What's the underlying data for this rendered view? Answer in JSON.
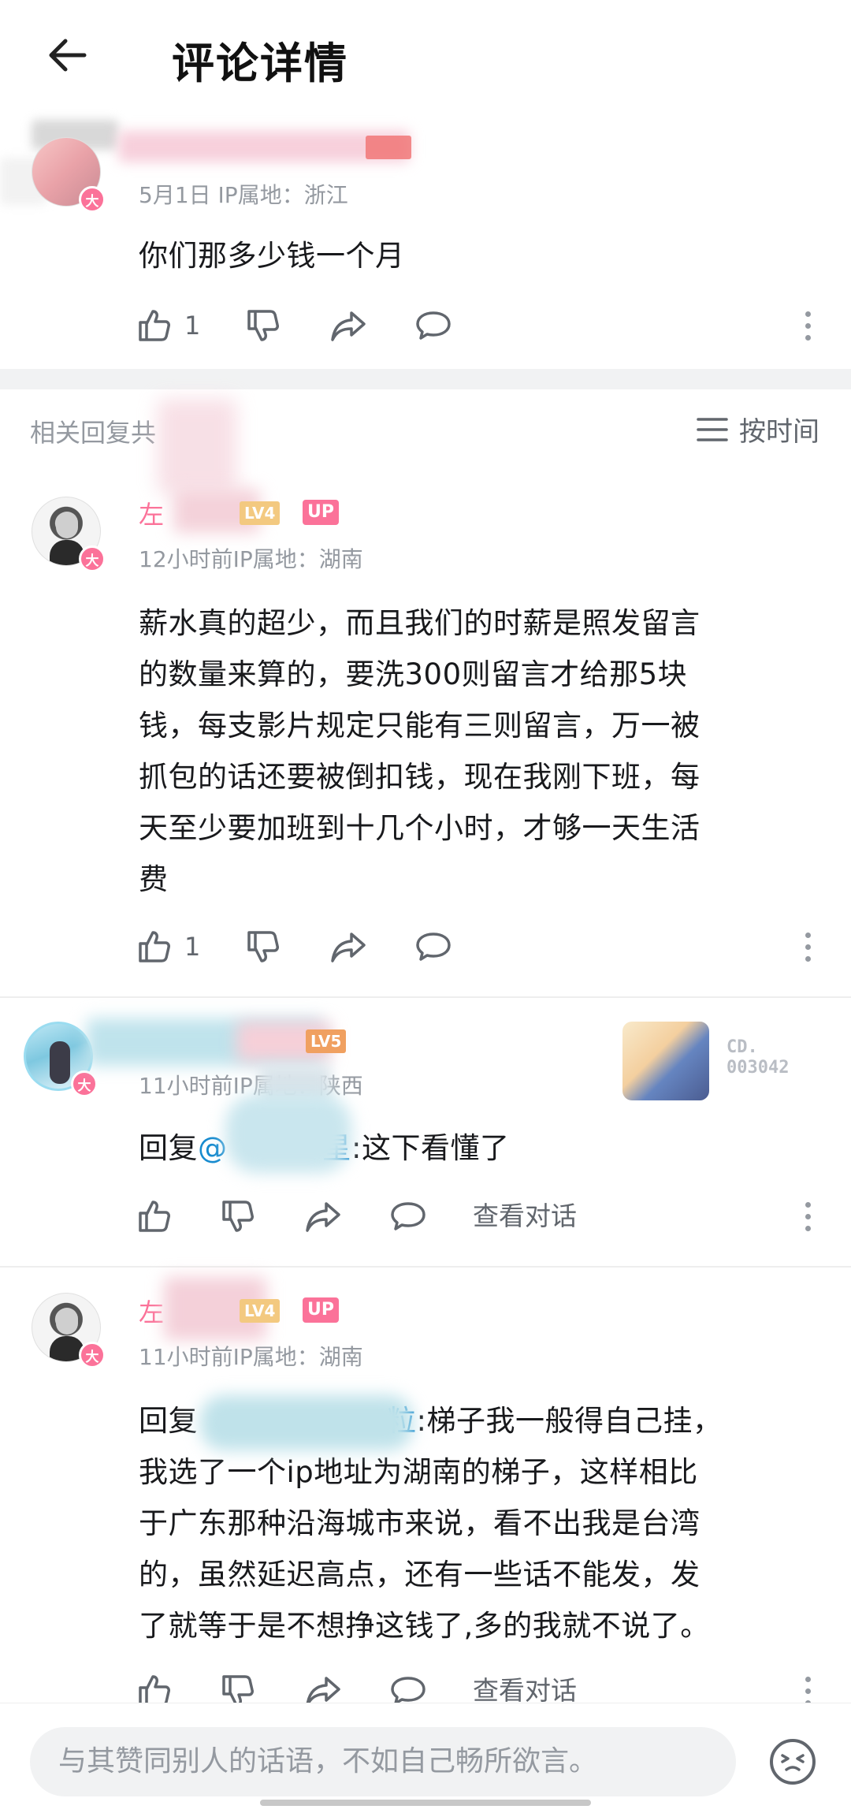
{
  "header": {
    "title": "评论详情"
  },
  "root_comment": {
    "time": "5月1日",
    "ip": "IP属地：浙江",
    "text": "你们那多少钱一个月",
    "likes": "1"
  },
  "replies_section": {
    "title": "相关回复共",
    "sort_label": "按时间"
  },
  "replies": [
    {
      "username": "左",
      "level": "LV4",
      "up_tag": "UP",
      "time": "12小时前",
      "ip": "IP属地：湖南",
      "lines": [
        "薪水真的超少，而且我们的时薪是照发留言",
        "的数量来算的，要洗300则留言才给那5块",
        "钱，每支影片规定只能有三则留言，万一被",
        "抓包的话还要被倒扣钱，现在我刚下班，每",
        "天至少要加班到十几个小时，才够一天生活",
        "费"
      ],
      "likes": "1"
    },
    {
      "level": "LV5",
      "time": "11小时前",
      "ip": "IP属地：陕西",
      "reply_prefix": "回复",
      "reply_to": "@",
      "reply_to_tail": "星",
      "text": ":这下看懂了",
      "view_conversation": "查看对话",
      "badge_number": [
        "CD.",
        "003042"
      ]
    },
    {
      "username": "左",
      "level": "LV4",
      "up_tag": "UP",
      "time": "11小时前",
      "ip": "IP属地：湖南",
      "reply_prefix": "回复",
      "reply_to_tail": "粒",
      "first_line_text": ":梯子我一般得自己挂，",
      "lines": [
        "我选了一个ip地址为湖南的梯子，这样相比",
        "于广东那种沿海城市来说，看不出我是台湾",
        "的，虽然延迟高点，还有一些话不能发，发",
        "了就等于是不想挣这钱了,多的我就不说了。"
      ],
      "view_conversation": "查看对话"
    }
  ],
  "composer": {
    "placeholder": "与其赞同别人的话语，不如自己畅所欲言。"
  },
  "colors": {
    "accent_pink": "#fb7299",
    "link_blue": "#178bcf",
    "level_gold": "#f3c980"
  }
}
